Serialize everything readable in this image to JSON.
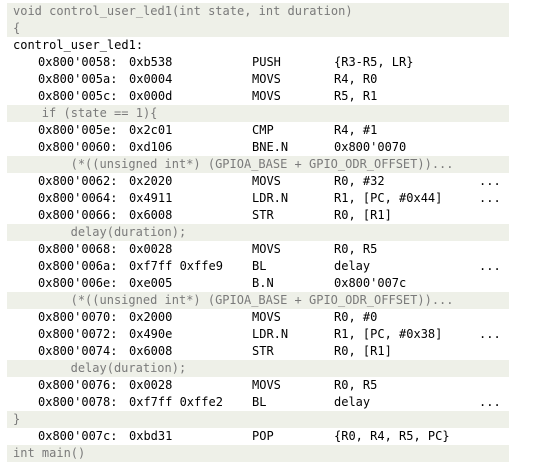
{
  "rows": [
    {
      "kind": "src",
      "indent": 0,
      "text": "void control_user_led1(int state, int duration)"
    },
    {
      "kind": "src",
      "indent": 0,
      "text": "{"
    },
    {
      "kind": "label",
      "text": "control_user_led1:"
    },
    {
      "kind": "asm",
      "addr": "0x800'0058:",
      "bytes": "0xb538",
      "mnem": "PUSH",
      "ops": "{R3-R5, LR}",
      "more": ""
    },
    {
      "kind": "asm",
      "addr": "0x800'005a:",
      "bytes": "0x0004",
      "mnem": "MOVS",
      "ops": "R4, R0",
      "more": ""
    },
    {
      "kind": "asm",
      "addr": "0x800'005c:",
      "bytes": "0x000d",
      "mnem": "MOVS",
      "ops": "R5, R1",
      "more": ""
    },
    {
      "kind": "src",
      "indent": 4,
      "text": "if (state == 1){"
    },
    {
      "kind": "asm",
      "addr": "0x800'005e:",
      "bytes": "0x2c01",
      "mnem": "CMP",
      "ops": "R4, #1",
      "more": ""
    },
    {
      "kind": "asm",
      "addr": "0x800'0060:",
      "bytes": "0xd106",
      "mnem": "BNE.N",
      "ops": "0x800'0070",
      "more": ""
    },
    {
      "kind": "src",
      "indent": 8,
      "text": "(*((unsigned int*) (GPIOA_BASE + GPIO_ODR_OFFSET))..."
    },
    {
      "kind": "asm",
      "addr": "0x800'0062:",
      "bytes": "0x2020",
      "mnem": "MOVS",
      "ops": "R0, #32",
      "more": "..."
    },
    {
      "kind": "asm",
      "addr": "0x800'0064:",
      "bytes": "0x4911",
      "mnem": "LDR.N",
      "ops": "R1, [PC, #0x44]",
      "more": "..."
    },
    {
      "kind": "asm",
      "addr": "0x800'0066:",
      "bytes": "0x6008",
      "mnem": "STR",
      "ops": "R0, [R1]",
      "more": ""
    },
    {
      "kind": "src",
      "indent": 8,
      "text": "delay(duration);"
    },
    {
      "kind": "asm",
      "addr": "0x800'0068:",
      "bytes": "0x0028",
      "mnem": "MOVS",
      "ops": "R0, R5",
      "more": ""
    },
    {
      "kind": "asm",
      "addr": "0x800'006a:",
      "bytes": "0xf7ff 0xffe9",
      "mnem": "BL",
      "ops": "delay",
      "more": "..."
    },
    {
      "kind": "asm",
      "addr": "0x800'006e:",
      "bytes": "0xe005",
      "mnem": "B.N",
      "ops": "0x800'007c",
      "more": ""
    },
    {
      "kind": "src",
      "indent": 8,
      "text": "(*((unsigned int*) (GPIOA_BASE + GPIO_ODR_OFFSET))..."
    },
    {
      "kind": "asm",
      "addr": "0x800'0070:",
      "bytes": "0x2000",
      "mnem": "MOVS",
      "ops": "R0, #0",
      "more": ""
    },
    {
      "kind": "asm",
      "addr": "0x800'0072:",
      "bytes": "0x490e",
      "mnem": "LDR.N",
      "ops": "R1, [PC, #0x38]",
      "more": "..."
    },
    {
      "kind": "asm",
      "addr": "0x800'0074:",
      "bytes": "0x6008",
      "mnem": "STR",
      "ops": "R0, [R1]",
      "more": ""
    },
    {
      "kind": "src",
      "indent": 8,
      "text": "delay(duration);"
    },
    {
      "kind": "asm",
      "addr": "0x800'0076:",
      "bytes": "0x0028",
      "mnem": "MOVS",
      "ops": "R0, R5",
      "more": ""
    },
    {
      "kind": "asm",
      "addr": "0x800'0078:",
      "bytes": "0xf7ff 0xffe2",
      "mnem": "BL",
      "ops": "delay",
      "more": "..."
    },
    {
      "kind": "src",
      "indent": 0,
      "text": "}"
    },
    {
      "kind": "asm",
      "addr": "0x800'007c:",
      "bytes": "0xbd31",
      "mnem": "POP",
      "ops": "{R0, R4, R5, PC}",
      "more": ""
    },
    {
      "kind": "src",
      "indent": 0,
      "text": "int main()"
    }
  ]
}
